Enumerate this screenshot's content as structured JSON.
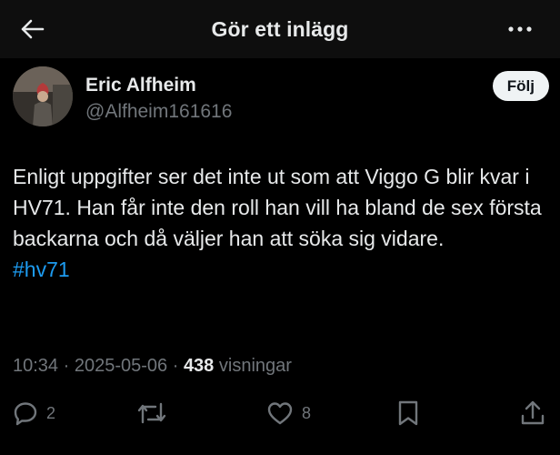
{
  "header": {
    "title": "Gör ett inlägg",
    "back_icon": "arrow-left-icon",
    "more_icon": "more-horizontal-icon"
  },
  "author": {
    "name": "Eric Alfheim",
    "handle": "@Alfheim161616",
    "follow_label": "Följ"
  },
  "tweet": {
    "text": "Enligt uppgifter ser det inte ut som att Viggo G blir kvar i HV71. Han får inte den roll han vill ha bland de sex första backarna och då väljer han att söka sig vidare.",
    "hashtag": "#hv71"
  },
  "meta": {
    "time": "10:34",
    "date": "2025-05-06",
    "views_count": "438",
    "views_label": "visningar"
  },
  "actions": {
    "reply_count": "2",
    "like_count": "8"
  },
  "colors": {
    "background": "#000000",
    "text": "#e7e9ea",
    "secondary": "#71767b",
    "link": "#1d9bf0",
    "follow_bg": "#eff3f4"
  }
}
